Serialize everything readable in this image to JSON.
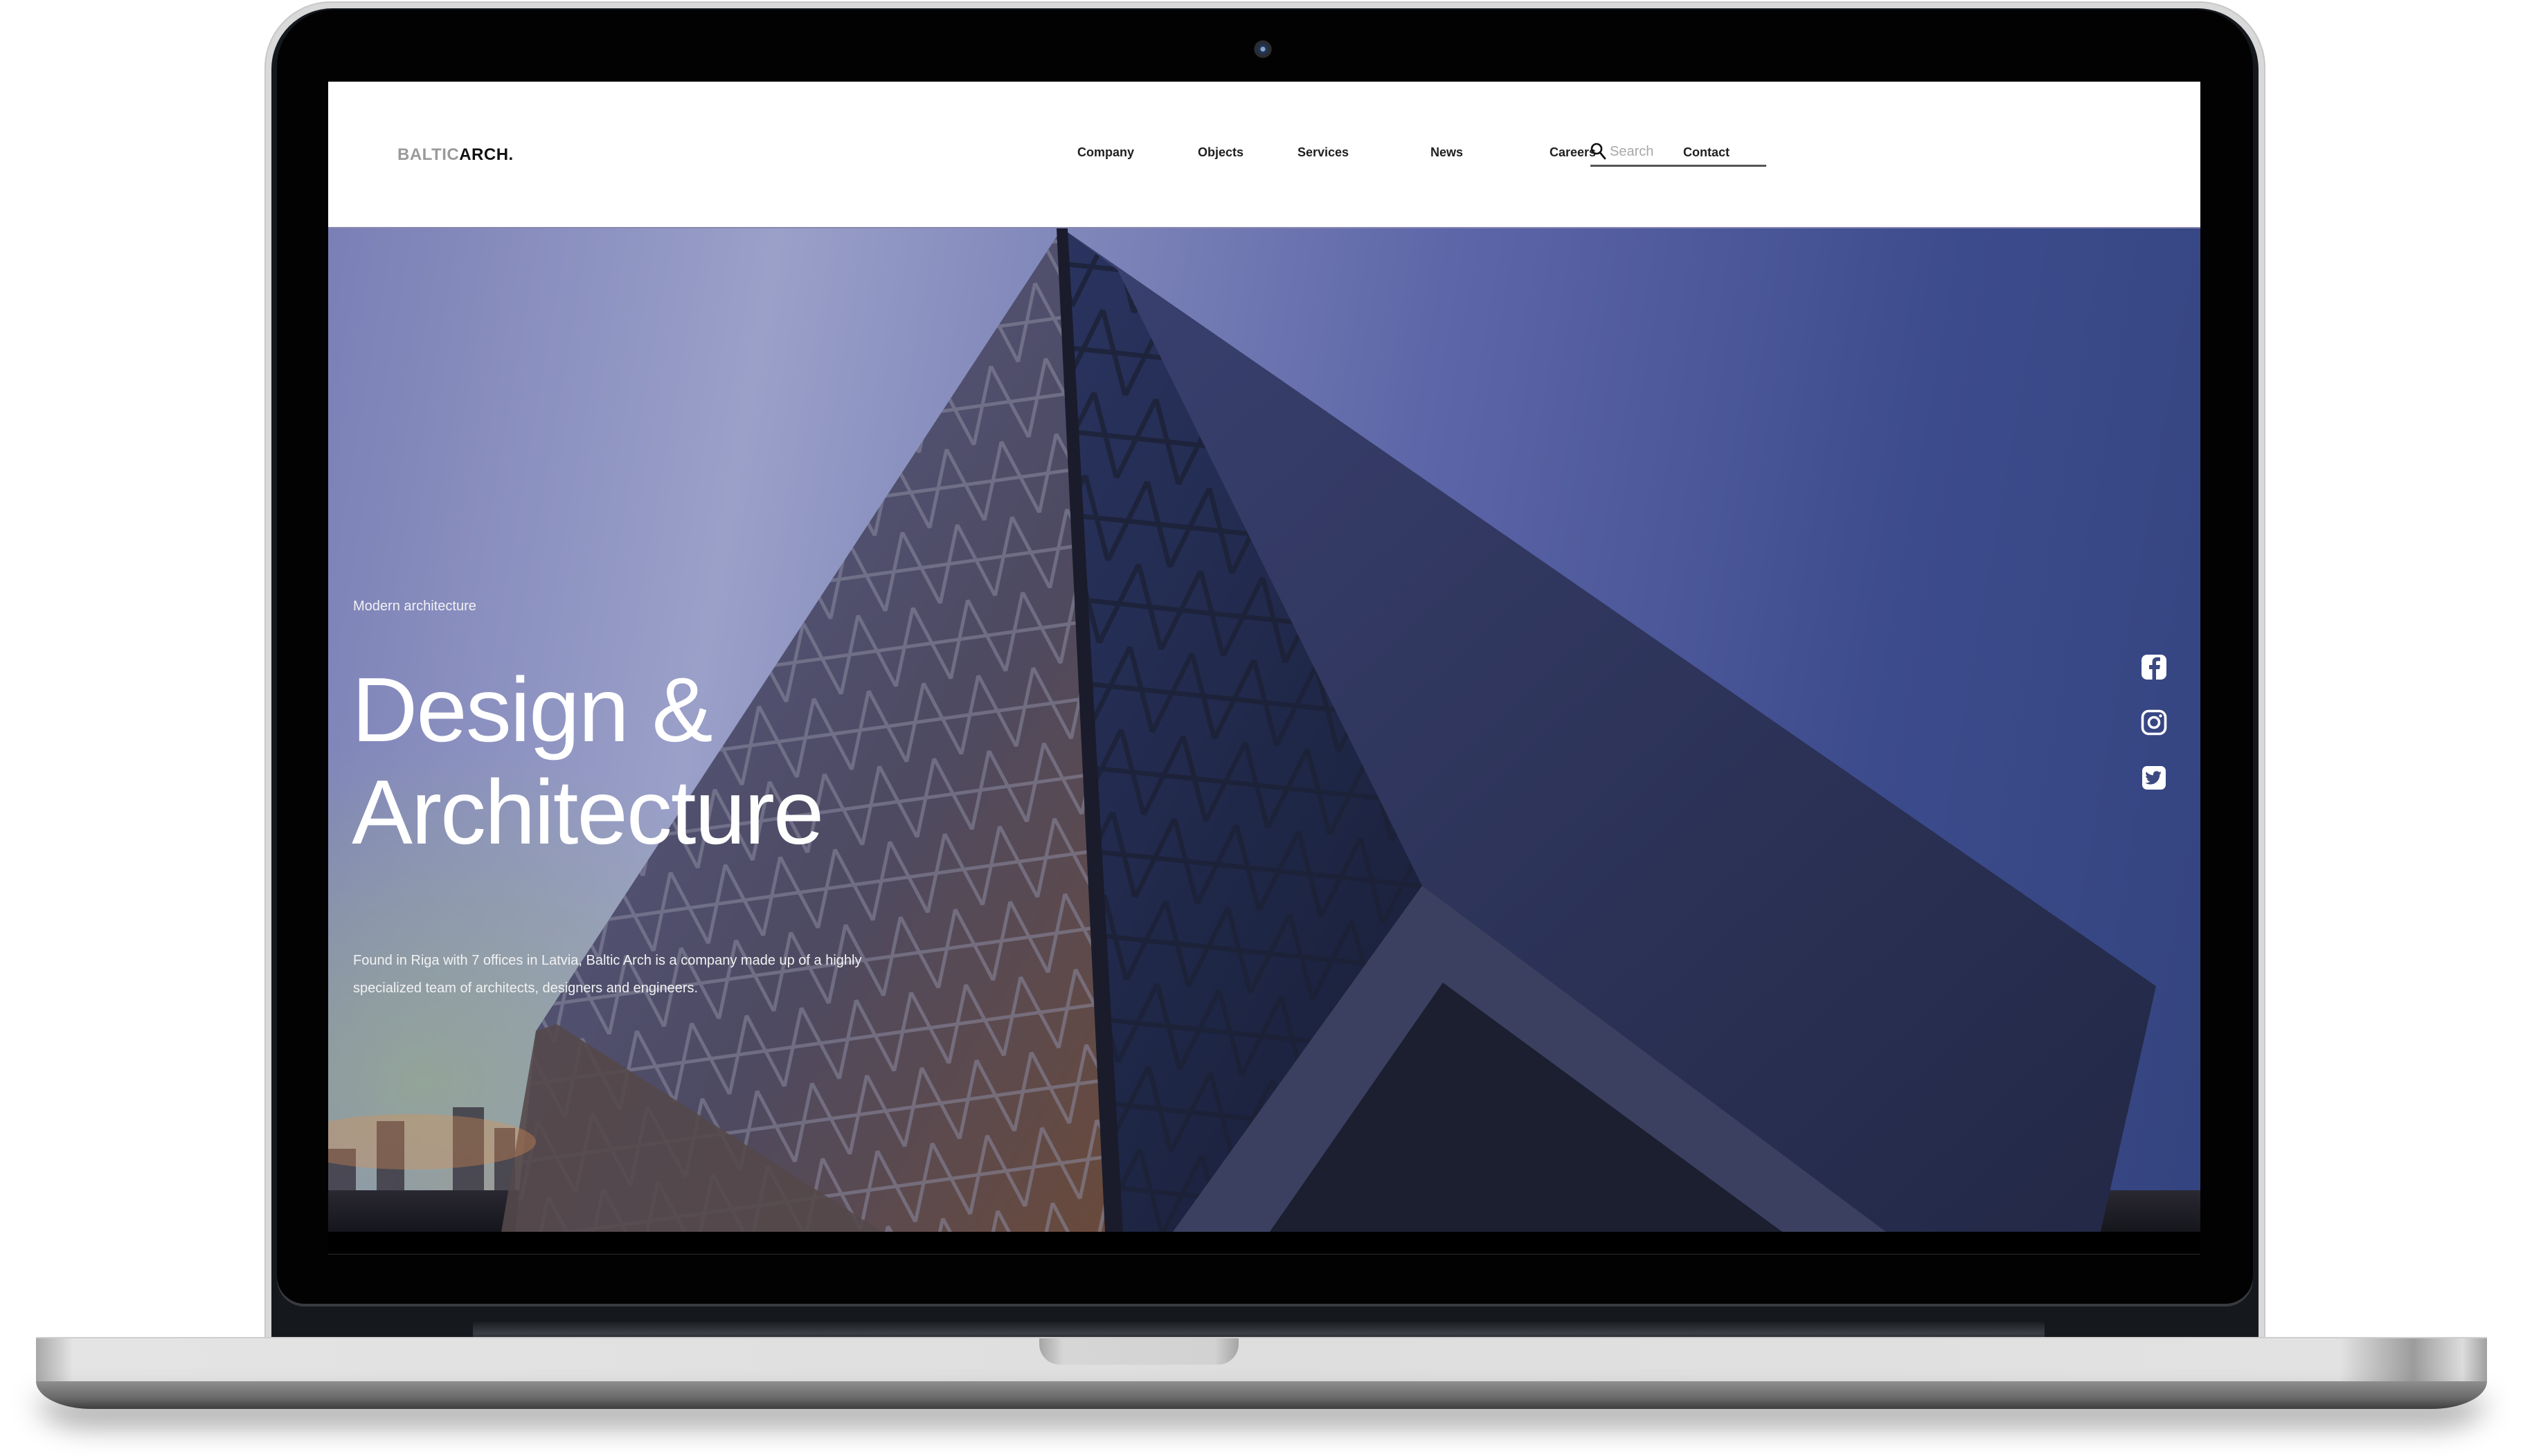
{
  "site": {
    "logo": {
      "light": "BALTIC",
      "dark": "ARCH."
    },
    "nav": [
      {
        "label": "Company"
      },
      {
        "label": "Objects"
      },
      {
        "label": "Services"
      },
      {
        "label": "News"
      },
      {
        "label": "Careers"
      },
      {
        "label": "Contact"
      }
    ],
    "search": {
      "placeholder": "Search",
      "value": "",
      "icon": "search-icon"
    }
  },
  "hero": {
    "eyebrow": "Modern architecture",
    "title_line1": "Design &",
    "title_line2": "Architecture",
    "description": "Found in Riga with 7 offices in Latvia, Baltic Arch is a company made up of a highly specialized team of architects, designers and engineers."
  },
  "social": [
    {
      "name": "Facebook",
      "icon": "facebook-icon"
    },
    {
      "name": "Instagram",
      "icon": "instagram-icon"
    },
    {
      "name": "Twitter",
      "icon": "twitter-icon"
    }
  ],
  "colors": {
    "header_bg": "#ffffff",
    "logo_light": "#9a9a9a",
    "logo_dark": "#111111",
    "nav_text": "#1f1f1f",
    "hero_sky_left": "#7a7fb6",
    "hero_sky_right": "#34447f",
    "hero_text": "#ffffff"
  }
}
